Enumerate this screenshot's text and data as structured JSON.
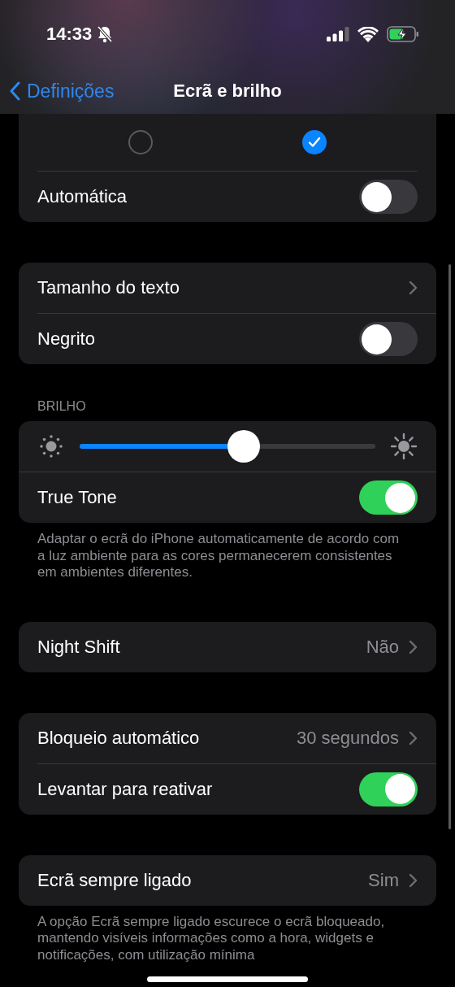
{
  "status_bar": {
    "time": "14:33"
  },
  "nav": {
    "back_label": "Definições",
    "title": "Ecrã e brilho"
  },
  "appearance": {
    "options": [
      {
        "selected": false
      },
      {
        "selected": true
      }
    ],
    "automatic": {
      "label": "Automática",
      "on": false
    }
  },
  "sections": [
    {
      "rows": [
        {
          "kind": "chevron",
          "label": "Tamanho do texto"
        },
        {
          "kind": "toggle",
          "label": "Negrito",
          "on": false
        }
      ]
    },
    {
      "header": "BRILHO",
      "rows": [
        {
          "kind": "slider",
          "level": 0.555
        },
        {
          "kind": "toggle",
          "label": "True Tone",
          "on": true
        }
      ],
      "footer": "Adaptar o ecrã do iPhone automaticamente de acordo com a luz ambiente para as cores permanecerem consistentes em ambientes diferentes."
    },
    {
      "rows": [
        {
          "kind": "chevron",
          "label": "Night Shift",
          "value": "Não"
        }
      ]
    },
    {
      "rows": [
        {
          "kind": "chevron",
          "label": "Bloqueio automático",
          "value": "30 segundos"
        },
        {
          "kind": "toggle",
          "label": "Levantar para reativar",
          "on": true
        }
      ]
    },
    {
      "rows": [
        {
          "kind": "chevron",
          "label": "Ecrã sempre ligado",
          "value": "Sim"
        }
      ],
      "footer": "A opção Ecrã sempre ligado escurece o ecrã bloqueado, mantendo visíveis informações como a hora, widgets e notificações, com utilização mínima"
    }
  ]
}
